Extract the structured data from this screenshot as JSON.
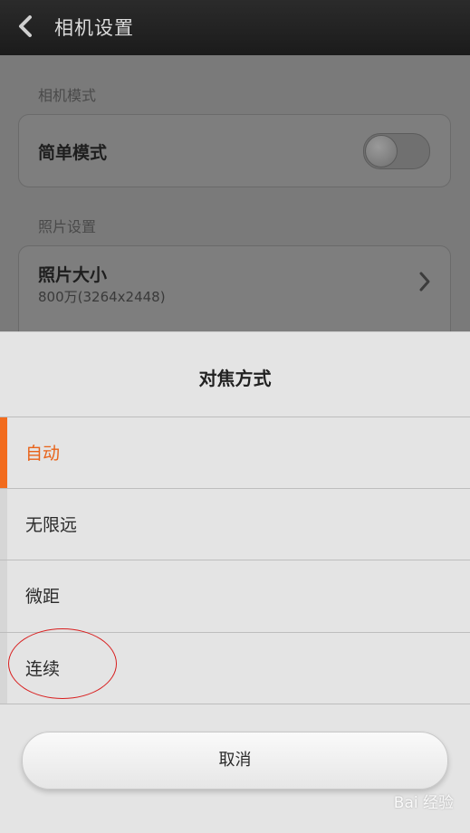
{
  "titlebar": {
    "title": "相机设置"
  },
  "settings": {
    "mode_section": "相机模式",
    "simple_mode_label": "简单模式",
    "simple_mode_on": false,
    "photo_section": "照片设置",
    "photo_size_label": "照片大小",
    "photo_size_value": "800万(3264x2448)"
  },
  "sheet": {
    "title": "对焦方式",
    "options": [
      {
        "label": "自动",
        "selected": true
      },
      {
        "label": "无限远",
        "selected": false
      },
      {
        "label": "微距",
        "selected": false
      },
      {
        "label": "连续",
        "selected": false
      }
    ],
    "cancel_label": "取消"
  },
  "watermark": "Bai 经验",
  "colors": {
    "accent": "#f26b1d",
    "annotation": "#d81e1e"
  }
}
